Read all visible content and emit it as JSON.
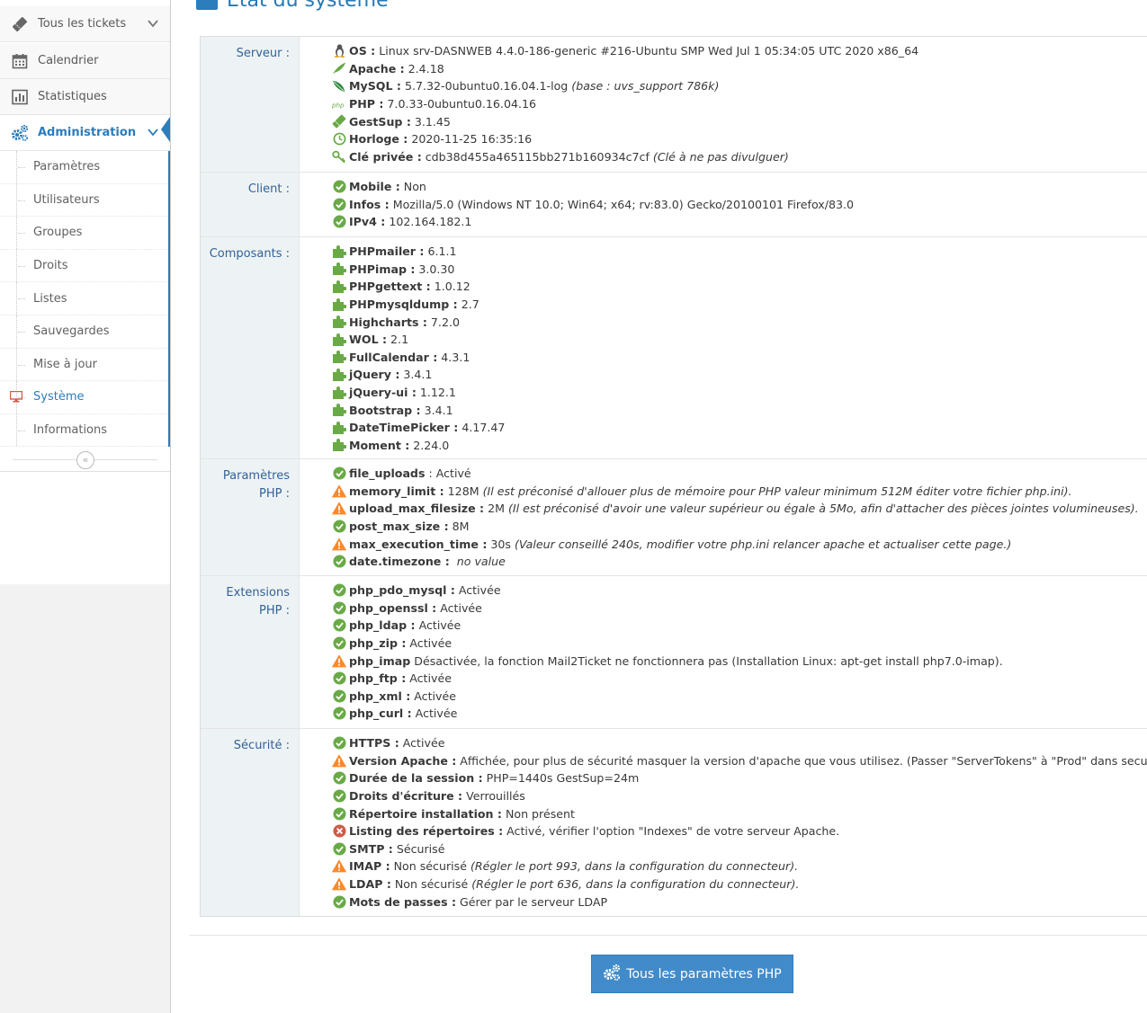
{
  "page": {
    "title": "État du système"
  },
  "sidebar": {
    "items": [
      {
        "label": "Tous les tickets"
      },
      {
        "label": "Calendrier"
      },
      {
        "label": "Statistiques"
      },
      {
        "label": "Administration"
      }
    ],
    "submenu": [
      {
        "label": "Paramètres"
      },
      {
        "label": "Utilisateurs"
      },
      {
        "label": "Groupes"
      },
      {
        "label": "Droits"
      },
      {
        "label": "Listes"
      },
      {
        "label": "Sauvegardes"
      },
      {
        "label": "Mise à jour"
      },
      {
        "label": "Système"
      },
      {
        "label": "Informations"
      }
    ],
    "collapse_glyph": "«"
  },
  "colors": {
    "accent": "#2b7dbc",
    "ok": "#69aa46",
    "warning": "#ff892a",
    "error": "#d15b47",
    "button": "#428bca"
  },
  "sections": {
    "server": {
      "label": "Serveur :",
      "rows": [
        {
          "icon": "linux-icon",
          "key": "OS :",
          "value": "Linux srv-DASNWEB 4.4.0-186-generic #216-Ubuntu SMP Wed Jul 1 05:34:05 UTC 2020 x86_64",
          "note": ""
        },
        {
          "icon": "apache-feather-icon",
          "key": "Apache :",
          "value": "2.4.18",
          "note": ""
        },
        {
          "icon": "mysql-leaf-icon",
          "key": "MySQL :",
          "value": "5.7.32-0ubuntu0.16.04.1-log",
          "note": "(base : uvs_support 786k)"
        },
        {
          "icon": "php-icon",
          "key": "PHP :",
          "value": "7.0.33-0ubuntu0.16.04.16",
          "note": ""
        },
        {
          "icon": "ticket-icon",
          "key": "GestSup :",
          "value": "3.1.45",
          "note": ""
        },
        {
          "icon": "clock-icon",
          "key": "Horloge :",
          "value": "2020-11-25 16:35:16",
          "note": ""
        },
        {
          "icon": "key-icon",
          "key": "Clé privée :",
          "value": "cdb38d455a465115bb271b160934c7cf",
          "note": "(Clé à ne pas divulguer)"
        }
      ]
    },
    "client": {
      "label": "Client :",
      "rows": [
        {
          "icon": "check-icon",
          "key": "Mobile :",
          "value": "Non",
          "note": ""
        },
        {
          "icon": "check-icon",
          "key": "Infos :",
          "value": "Mozilla/5.0 (Windows NT 10.0; Win64; x64; rv:83.0) Gecko/20100101 Firefox/83.0",
          "note": ""
        },
        {
          "icon": "check-icon",
          "key": "IPv4 :",
          "value": "102.164.182.1",
          "note": ""
        }
      ]
    },
    "components": {
      "label": "Composants :",
      "rows": [
        {
          "icon": "puzzle-icon",
          "key": "PHPmailer :",
          "value": "6.1.1",
          "note": ""
        },
        {
          "icon": "puzzle-icon",
          "key": "PHPimap :",
          "value": "3.0.30",
          "note": ""
        },
        {
          "icon": "puzzle-icon",
          "key": "PHPgettext :",
          "value": "1.0.12",
          "note": ""
        },
        {
          "icon": "puzzle-icon",
          "key": "PHPmysqldump :",
          "value": "2.7",
          "note": ""
        },
        {
          "icon": "puzzle-icon",
          "key": "Highcharts :",
          "value": "7.2.0",
          "note": ""
        },
        {
          "icon": "puzzle-icon",
          "key": "WOL :",
          "value": "2.1",
          "note": ""
        },
        {
          "icon": "puzzle-icon",
          "key": "FullCalendar :",
          "value": "4.3.1",
          "note": ""
        },
        {
          "icon": "puzzle-icon",
          "key": "jQuery :",
          "value": "3.4.1",
          "note": ""
        },
        {
          "icon": "puzzle-icon",
          "key": "jQuery-ui :",
          "value": "1.12.1",
          "note": ""
        },
        {
          "icon": "puzzle-icon",
          "key": "Bootstrap :",
          "value": "3.4.1",
          "note": ""
        },
        {
          "icon": "puzzle-icon",
          "key": "DateTimePicker :",
          "value": "4.17.47",
          "note": ""
        },
        {
          "icon": "puzzle-icon",
          "key": "Moment :",
          "value": "2.24.0",
          "note": ""
        }
      ]
    },
    "php_params": {
      "label_line1": "Paramètres",
      "label_line2": "PHP :",
      "rows": [
        {
          "icon": "check-icon",
          "key": "file_uploads",
          "value": ": Activé",
          "note": ""
        },
        {
          "icon": "warning-icon",
          "key": "memory_limit :",
          "value": "128M",
          "note": "(Il est préconisé d'allouer plus de mémoire pour PHP valeur minimum 512M éditer votre fichier php.ini)."
        },
        {
          "icon": "warning-icon",
          "key": "upload_max_filesize :",
          "value": "2M",
          "note": "(Il est préconisé d'avoir une valeur supérieur ou égale à 5Mo, afin d'attacher des pièces jointes volumineuses)."
        },
        {
          "icon": "check-icon",
          "key": "post_max_size :",
          "value": "8M",
          "note": ""
        },
        {
          "icon": "warning-icon",
          "key": "max_execution_time :",
          "value": "30s",
          "note": "(Valeur conseillé 240s, modifier votre php.ini relancer apache et actualiser cette page.)"
        },
        {
          "icon": "check-icon",
          "key": "date.timezone :",
          "value": "",
          "note": "no value"
        }
      ]
    },
    "php_ext": {
      "label_line1": "Extensions",
      "label_line2": "PHP :",
      "rows": [
        {
          "icon": "check-icon",
          "key": "php_pdo_mysql :",
          "value": "Activée",
          "note": ""
        },
        {
          "icon": "check-icon",
          "key": "php_openssl :",
          "value": "Activée",
          "note": ""
        },
        {
          "icon": "check-icon",
          "key": "php_ldap :",
          "value": "Activée",
          "note": ""
        },
        {
          "icon": "check-icon",
          "key": "php_zip :",
          "value": "Activée",
          "note": ""
        },
        {
          "icon": "warning-icon",
          "key": "php_imap",
          "value": "Désactivée, la fonction Mail2Ticket ne fonctionnera pas (Installation Linux: apt-get install php7.0-imap).",
          "note": ""
        },
        {
          "icon": "check-icon",
          "key": "php_ftp :",
          "value": "Activée",
          "note": ""
        },
        {
          "icon": "check-icon",
          "key": "php_xml :",
          "value": "Activée",
          "note": ""
        },
        {
          "icon": "check-icon",
          "key": "php_curl :",
          "value": "Activée",
          "note": ""
        }
      ]
    },
    "security": {
      "label": "Sécurité :",
      "rows": [
        {
          "icon": "check-icon",
          "key": "HTTPS :",
          "value": "Activée",
          "note": ""
        },
        {
          "icon": "warning-icon",
          "key": "Version Apache :",
          "value": "Affichée, pour plus de sécurité masquer la version d'apache que vous utilisez. (Passer \"ServerTokens\" à \"Prod\" dans security.conf)",
          "note": ""
        },
        {
          "icon": "check-icon",
          "key": "Durée de la session :",
          "value": "PHP=1440s GestSup=24m",
          "note": ""
        },
        {
          "icon": "check-icon",
          "key": "Droits d'écriture :",
          "value": "Verrouillés",
          "note": ""
        },
        {
          "icon": "check-icon",
          "key": "Répertoire installation :",
          "value": "Non présent",
          "note": ""
        },
        {
          "icon": "error-icon",
          "key": "Listing des répertoires :",
          "value": "Activé, vérifier l'option \"Indexes\" de votre serveur Apache.",
          "note": ""
        },
        {
          "icon": "check-icon",
          "key": "SMTP :",
          "value": "Sécurisé",
          "note": ""
        },
        {
          "icon": "warning-icon",
          "key": "IMAP :",
          "value": "Non sécurisé",
          "note": "(Régler le port 993, dans la configuration du connecteur)."
        },
        {
          "icon": "warning-icon",
          "key": "LDAP :",
          "value": "Non sécurisé",
          "note": "(Régler le port 636, dans la configuration du connecteur)."
        },
        {
          "icon": "check-icon",
          "key": "Mots de passes :",
          "value": "Gérer par le serveur LDAP",
          "note": ""
        }
      ]
    }
  },
  "button": {
    "label": "Tous les paramètres PHP"
  }
}
